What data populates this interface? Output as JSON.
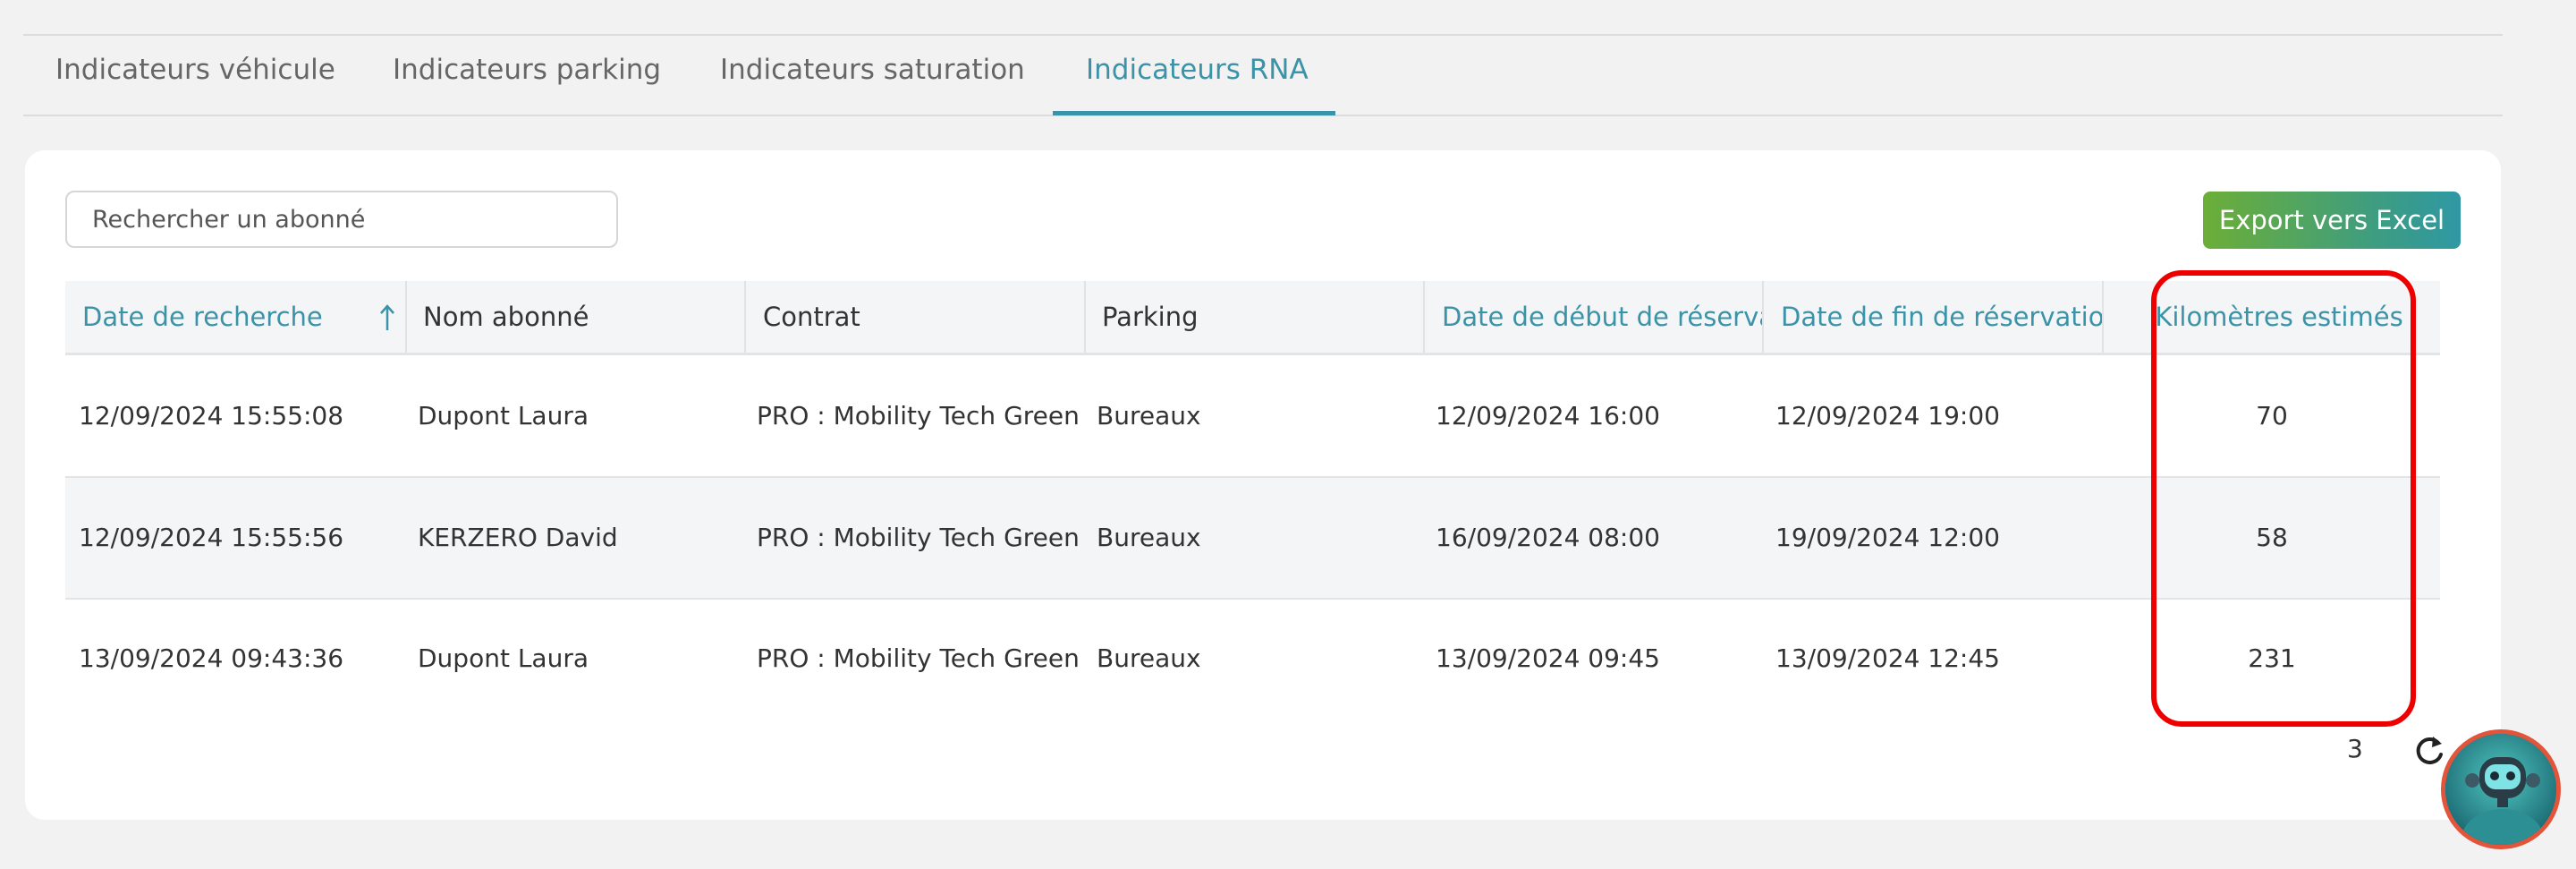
{
  "tabs": [
    {
      "label": "Indicateurs véhicule",
      "active": false
    },
    {
      "label": "Indicateurs parking",
      "active": false
    },
    {
      "label": "Indicateurs saturation",
      "active": false
    },
    {
      "label": "Indicateurs RNA",
      "active": true
    }
  ],
  "search": {
    "placeholder": "Rechercher un abonné",
    "value": ""
  },
  "toolbar": {
    "export_label": "Export vers Excel"
  },
  "table": {
    "columns": [
      {
        "label": "Date de recherche",
        "sortable": true,
        "sorted": "asc"
      },
      {
        "label": "Nom abonné",
        "sortable": false
      },
      {
        "label": "Contrat",
        "sortable": false
      },
      {
        "label": "Parking",
        "sortable": false
      },
      {
        "label": "Date de début de réservati",
        "sortable": true
      },
      {
        "label": "Date de fin de réservation",
        "sortable": true
      },
      {
        "label": "Kilomètres estimés",
        "sortable": true
      }
    ],
    "rows": [
      [
        "12/09/2024 15:55:08",
        "Dupont Laura",
        "PRO : Mobility Tech Green",
        "Bureaux",
        "12/09/2024 16:00",
        "12/09/2024 19:00",
        "70"
      ],
      [
        "12/09/2024 15:55:56",
        "KERZERO David",
        "PRO : Mobility Tech Green",
        "Bureaux",
        "16/09/2024 08:00",
        "19/09/2024 12:00",
        "58"
      ],
      [
        "13/09/2024 09:43:36",
        "Dupont Laura",
        "PRO : Mobility Tech Green",
        "Bureaux",
        "13/09/2024 09:45",
        "13/09/2024 12:45",
        "231"
      ]
    ],
    "row_count": "3"
  },
  "icons": {
    "sort": "arrow-up-icon",
    "refresh": "refresh-icon",
    "assistant": "robot-avatar-icon"
  },
  "colors": {
    "accent": "#3a93a8",
    "export_gradient_start": "#6cae38",
    "export_gradient_end": "#2f98a4",
    "highlight": "#ee0000"
  }
}
